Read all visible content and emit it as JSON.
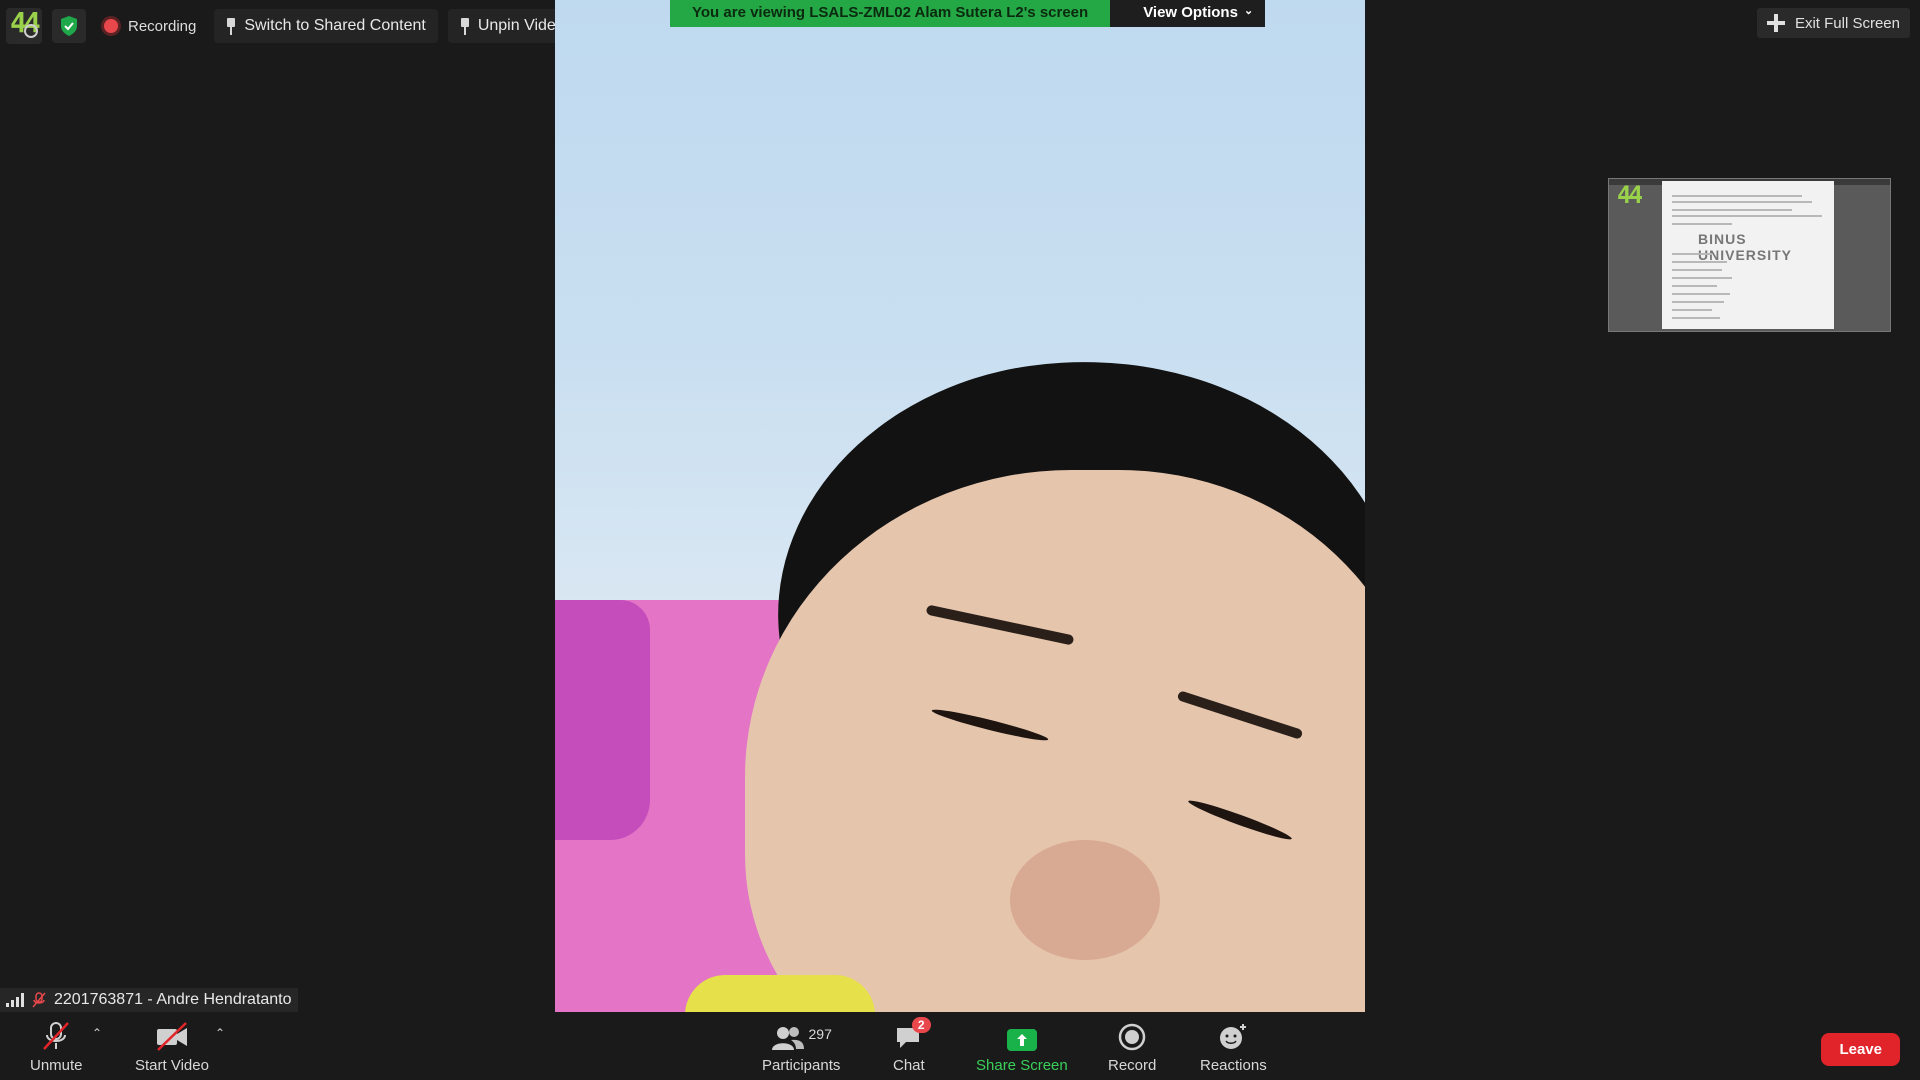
{
  "topbar": {
    "recording_label": "Recording",
    "switch_label": "Switch to Shared Content",
    "unpin_label": "Unpin Video"
  },
  "banner": {
    "message": "You are viewing LSALS-ZML02 Alam Sutera L2's screen",
    "view_options": "View Options"
  },
  "exit_fullscreen": "Exit Full Screen",
  "thumbnail": {
    "doc_logo_text": "BINUS UNIVERSITY"
  },
  "self_view": {
    "name": "2201763871 - Andre Hendratanto"
  },
  "toolbar": {
    "unmute": "Unmute",
    "start_video": "Start Video",
    "participants_count": "297",
    "participants": "Participants",
    "chat": "Chat",
    "chat_badge": "2",
    "share_screen": "Share Screen",
    "record": "Record",
    "reactions": "Reactions",
    "leave": "Leave"
  },
  "colors": {
    "accent_green": "#23a845",
    "leave_red": "#e0242a"
  }
}
